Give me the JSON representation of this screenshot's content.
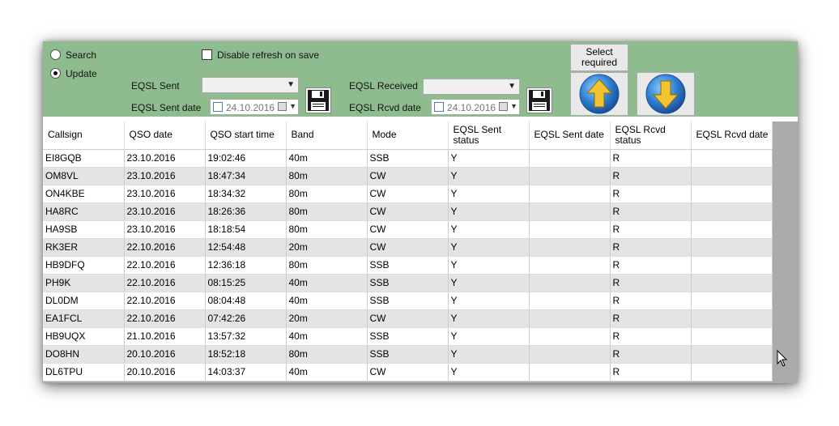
{
  "toolbar": {
    "mode_search_label": "Search",
    "mode_update_label": "Update",
    "disable_refresh_label": "Disable refresh on save",
    "eqsl_sent_label": "EQSL Sent",
    "eqsl_sent_date_label": "EQSL Sent date",
    "eqsl_sent_value": "",
    "eqsl_sent_date_value": "24.10.2016",
    "eqsl_received_label": "EQSL Received",
    "eqsl_rcvd_date_label": "EQSL Rcvd date",
    "eqsl_received_value": "",
    "eqsl_rcvd_date_value": "24.10.2016",
    "select_required_label": "Select\nrequired",
    "colors": {
      "background": "#8fbc8f",
      "arrow_blue": "#2f7fd1",
      "arrow_yellow": "#f4c430"
    }
  },
  "grid": {
    "columns": [
      "Callsign",
      "QSO date",
      "QSO start time",
      "Band",
      "Mode",
      "EQSL Sent status",
      "EQSL Sent date",
      "EQSL Rcvd status",
      "EQSL Rcvd date"
    ],
    "rows": [
      [
        "EI8GQB",
        "23.10.2016",
        "19:02:46",
        "40m",
        "SSB",
        "Y",
        "",
        "R",
        ""
      ],
      [
        "OM8VL",
        "23.10.2016",
        "18:47:34",
        "80m",
        "CW",
        "Y",
        "",
        "R",
        ""
      ],
      [
        "ON4KBE",
        "23.10.2016",
        "18:34:32",
        "80m",
        "CW",
        "Y",
        "",
        "R",
        ""
      ],
      [
        "HA8RC",
        "23.10.2016",
        "18:26:36",
        "80m",
        "CW",
        "Y",
        "",
        "R",
        ""
      ],
      [
        "HA9SB",
        "23.10.2016",
        "18:18:54",
        "80m",
        "CW",
        "Y",
        "",
        "R",
        ""
      ],
      [
        "RK3ER",
        "22.10.2016",
        "12:54:48",
        "20m",
        "CW",
        "Y",
        "",
        "R",
        ""
      ],
      [
        "HB9DFQ",
        "22.10.2016",
        "12:36:18",
        "80m",
        "SSB",
        "Y",
        "",
        "R",
        ""
      ],
      [
        "PH9K",
        "22.10.2016",
        "08:15:25",
        "40m",
        "SSB",
        "Y",
        "",
        "R",
        ""
      ],
      [
        "DL0DM",
        "22.10.2016",
        "08:04:48",
        "40m",
        "SSB",
        "Y",
        "",
        "R",
        ""
      ],
      [
        "EA1FCL",
        "22.10.2016",
        "07:42:26",
        "20m",
        "CW",
        "Y",
        "",
        "R",
        ""
      ],
      [
        "HB9UQX",
        "21.10.2016",
        "13:57:32",
        "40m",
        "SSB",
        "Y",
        "",
        "R",
        ""
      ],
      [
        "DO8HN",
        "20.10.2016",
        "18:52:18",
        "80m",
        "SSB",
        "Y",
        "",
        "R",
        ""
      ],
      [
        "DL6TPU",
        "20.10.2016",
        "14:03:37",
        "40m",
        "CW",
        "Y",
        "",
        "R",
        ""
      ]
    ]
  }
}
